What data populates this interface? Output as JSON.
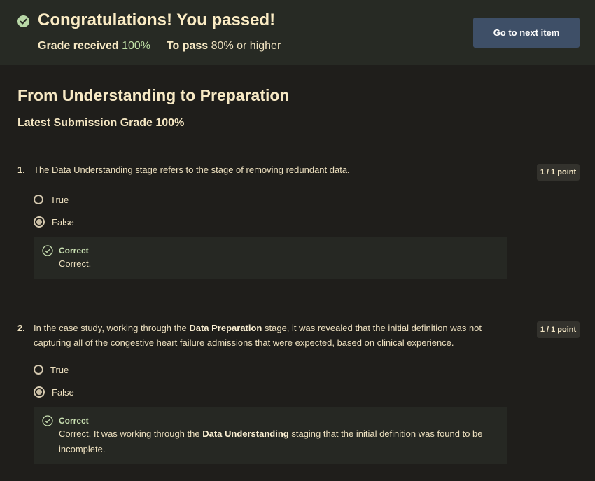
{
  "banner": {
    "title": "Congratulations! You passed!",
    "grade_received_label": "Grade received",
    "grade_received_value": "100%",
    "to_pass_label": "To pass",
    "to_pass_value": "80%",
    "to_pass_suffix": "or higher",
    "next_button": "Go to next item"
  },
  "quiz": {
    "title": "From Understanding to Preparation",
    "latest_grade": "Latest Submission Grade 100%"
  },
  "questions": [
    {
      "number": "1.",
      "text": "The Data Understanding stage refers to the stage of removing redundant data.",
      "points": "1 / 1 point",
      "options": [
        "True",
        "False"
      ],
      "selected": "False",
      "feedback_status": "Correct",
      "feedback_text": "Correct."
    },
    {
      "number": "2.",
      "text_before": "In the case study, working through the ",
      "text_bold": "Data Preparation",
      "text_after": " stage, it was revealed that the initial definition was not capturing all of the congestive heart failure admissions that were expected, based on clinical experience.",
      "points": "1 / 1 point",
      "options": [
        "True",
        "False"
      ],
      "selected": "False",
      "feedback_status": "Correct",
      "feedback_before": "Correct. It was working through the ",
      "feedback_bold": "Data Understanding",
      "feedback_after": " staging that the initial definition was found to be incomplete."
    }
  ],
  "colors": {
    "background": "#1f1e1b",
    "banner": "#272a24",
    "accent_green": "#bfe0a6",
    "button": "#3e4f67"
  }
}
